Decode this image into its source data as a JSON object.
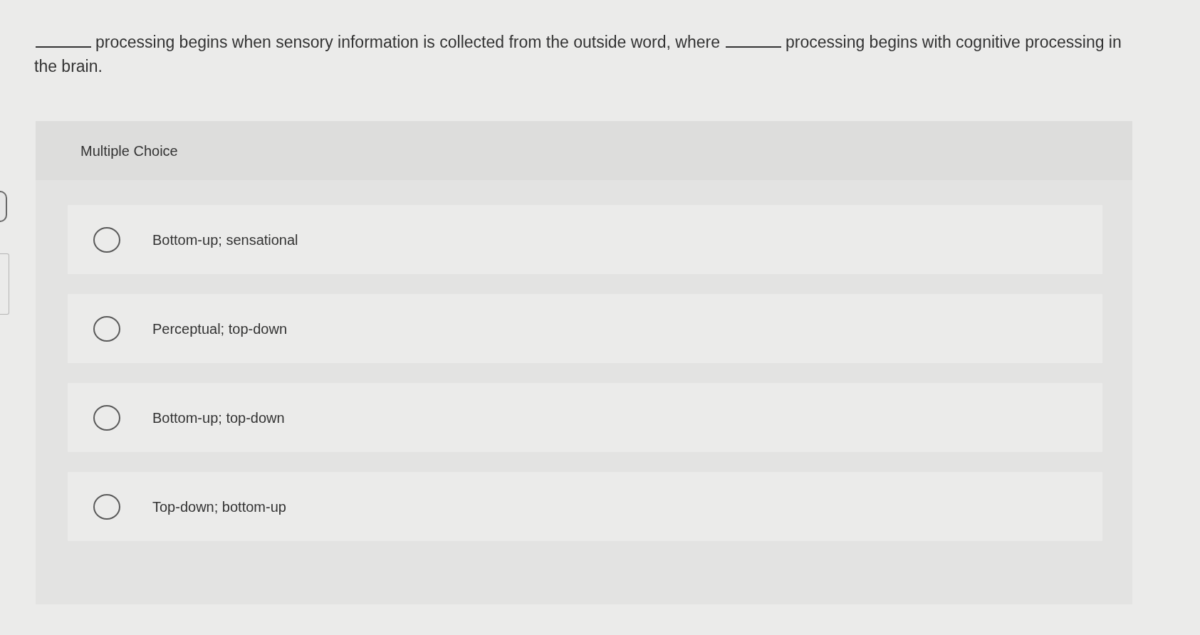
{
  "question": {
    "lines": [
      {
        "parts": [
          {
            "kind": "blank"
          },
          {
            "kind": "text",
            "text": "processing begins when sensory information is collected from the outside word, where"
          },
          {
            "kind": "blank"
          },
          {
            "kind": "text",
            "text": "processing begins with cognitive processing in"
          }
        ]
      },
      {
        "parts": [
          {
            "kind": "text",
            "text": "the brain."
          }
        ]
      }
    ]
  },
  "answer_area": {
    "heading": "Multiple Choice",
    "options": [
      {
        "label": "Bottom-up; sensational",
        "selected": false
      },
      {
        "label": "Perceptual; top-down",
        "selected": false
      },
      {
        "label": "Bottom-up; top-down",
        "selected": false
      },
      {
        "label": "Top-down; bottom-up",
        "selected": false
      }
    ]
  }
}
